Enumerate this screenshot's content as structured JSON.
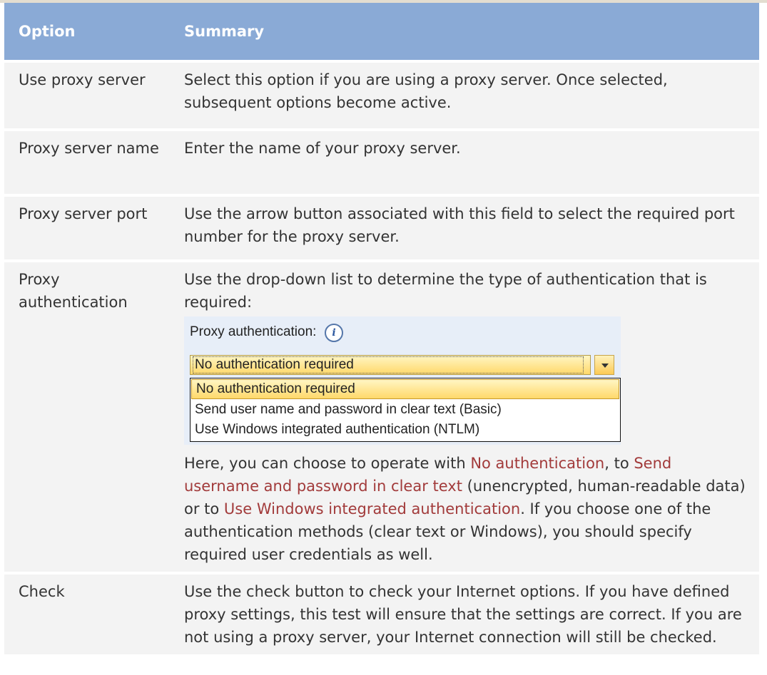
{
  "table": {
    "headers": {
      "option": "Option",
      "summary": "Summary"
    },
    "rows": [
      {
        "option": "Use proxy server",
        "summary": "Select this option if you are using a proxy server. Once selected, subsequent options become active."
      },
      {
        "option": "Proxy server name",
        "summary": "Enter the name of your proxy server."
      },
      {
        "option": "Proxy server port",
        "summary": "Use the arrow button associated with this field to select the required port number for the proxy server."
      },
      {
        "option": "Proxy authentication",
        "summary_intro": "Use the drop-down list to determine the type of authentication that is required:",
        "dropdown": {
          "label": "Proxy authentication:",
          "info_icon": "info-icon",
          "info_glyph": "i",
          "selected": "No authentication required",
          "options": [
            "No authentication required",
            "Send user name and password in clear text (Basic)",
            "Use Windows integrated authentication (NTLM)"
          ]
        },
        "note": {
          "part1": "Here, you can choose to operate with ",
          "link1": "No authentication",
          "part2": ", to ",
          "link2": "Send username and password in clear text",
          "part3": " (unencrypted, human-readable data) or to ",
          "link3": "Use Windows integrated authentication",
          "part4": ". If you choose one of the authentication methods (clear text or Windows), you should specify required user credentials as well."
        }
      },
      {
        "option": "Check",
        "summary": "Use the check button to check your Internet options. If you have defined proxy settings, this test will ensure that the settings are correct. If you are not using a proxy server, your Internet connection will still be checked."
      }
    ]
  },
  "colors": {
    "header_bg": "#8aaad6",
    "row_bg": "#f3f3f3",
    "link": "#a23b3b",
    "dropdown_highlight": "#ffd86a"
  }
}
